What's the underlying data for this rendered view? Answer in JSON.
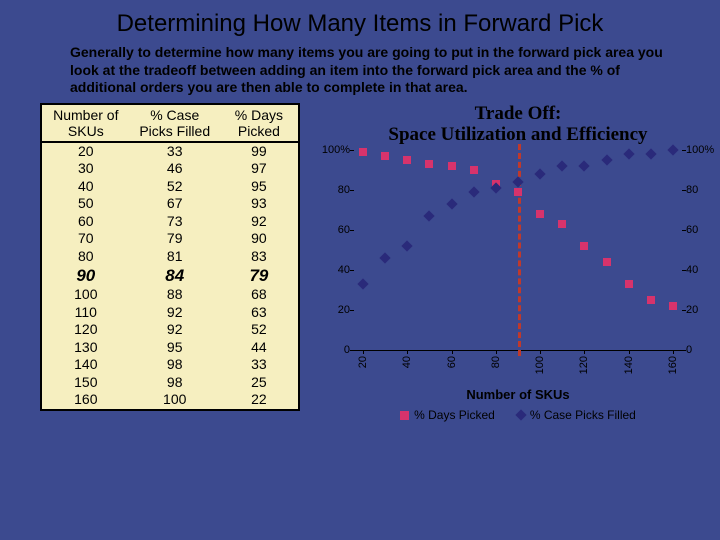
{
  "title": "Determining How Many Items in Forward Pick",
  "intro": "Generally to determine how many items you are going to put in the forward pick area you look at the tradeoff between adding an item into the forward pick area and the % of additional orders you are then able to complete in that area.",
  "table": {
    "headers": {
      "c1": "Number of SKUs",
      "c2": "% Case Picks Filled",
      "c3": "% Days Picked"
    },
    "rows": [
      {
        "sku": "20",
        "cpf": "33",
        "dp": "99",
        "hl": false
      },
      {
        "sku": "30",
        "cpf": "46",
        "dp": "97",
        "hl": false
      },
      {
        "sku": "40",
        "cpf": "52",
        "dp": "95",
        "hl": false
      },
      {
        "sku": "50",
        "cpf": "67",
        "dp": "93",
        "hl": false
      },
      {
        "sku": "60",
        "cpf": "73",
        "dp": "92",
        "hl": false
      },
      {
        "sku": "70",
        "cpf": "79",
        "dp": "90",
        "hl": false
      },
      {
        "sku": "80",
        "cpf": "81",
        "dp": "83",
        "hl": false
      },
      {
        "sku": "90",
        "cpf": "84",
        "dp": "79",
        "hl": true
      },
      {
        "sku": "100",
        "cpf": "88",
        "dp": "68",
        "hl": false
      },
      {
        "sku": "110",
        "cpf": "92",
        "dp": "63",
        "hl": false
      },
      {
        "sku": "120",
        "cpf": "92",
        "dp": "52",
        "hl": false
      },
      {
        "sku": "130",
        "cpf": "95",
        "dp": "44",
        "hl": false
      },
      {
        "sku": "140",
        "cpf": "98",
        "dp": "33",
        "hl": false
      },
      {
        "sku": "150",
        "cpf": "98",
        "dp": "25",
        "hl": false
      },
      {
        "sku": "160",
        "cpf": "100",
        "dp": "22",
        "hl": false
      }
    ]
  },
  "chart_data": {
    "type": "scatter",
    "title": "Trade Off:\nSpace Utilization and Efficiency",
    "xlabel": "Number of SKUs",
    "ylabel": "",
    "x": [
      20,
      30,
      40,
      50,
      60,
      70,
      80,
      90,
      100,
      110,
      120,
      130,
      140,
      150,
      160
    ],
    "xlim": [
      16,
      164
    ],
    "ylim": [
      0,
      100
    ],
    "yticks": [
      0,
      20,
      40,
      60,
      80,
      100
    ],
    "ytick_labels_left": [
      "0",
      "20",
      "40",
      "60",
      "80",
      "100%"
    ],
    "ytick_labels_right": [
      "0",
      "20",
      "40",
      "60",
      "80",
      "100%"
    ],
    "xticks": [
      20,
      40,
      60,
      80,
      100,
      120,
      140,
      160
    ],
    "vline_x": 90,
    "series": [
      {
        "name": "% Days Picked",
        "marker": "square",
        "color": "#d6336c",
        "values": [
          99,
          97,
          95,
          93,
          92,
          90,
          83,
          79,
          68,
          63,
          52,
          44,
          33,
          25,
          22
        ]
      },
      {
        "name": "% Case Picks Filled",
        "marker": "diamond",
        "color": "#2a2a7a",
        "values": [
          33,
          46,
          52,
          67,
          73,
          79,
          81,
          84,
          88,
          92,
          92,
          95,
          98,
          98,
          100
        ]
      }
    ],
    "legend": {
      "s1": "% Days Picked",
      "s2": "% Case Picks Filled"
    }
  }
}
